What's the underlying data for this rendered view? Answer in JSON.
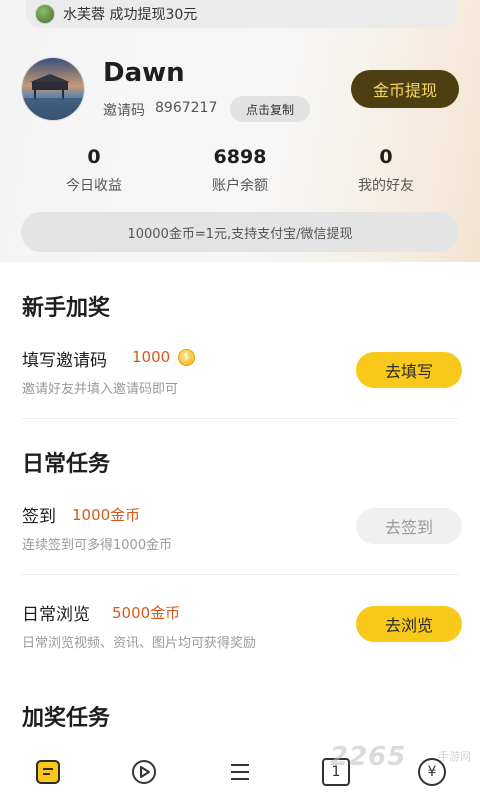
{
  "notice": {
    "text": "水芙蓉 成功提现30元"
  },
  "profile": {
    "username": "Dawn",
    "invite_label": "邀请码",
    "invite_code": "8967217",
    "copy_button": "点击复制",
    "withdraw_button": "金币提现"
  },
  "stats": [
    {
      "value": "0",
      "label": "今日收益"
    },
    {
      "value": "6898",
      "label": "账户余额"
    },
    {
      "value": "0",
      "label": "我的好友"
    }
  ],
  "rate_info": "10000金币=1元,支持支付宝/微信提现",
  "sections": {
    "newbie": {
      "title": "新手加奖",
      "task": {
        "title": "填写邀请码",
        "reward": "1000",
        "desc": "邀请好友并填入邀请码即可",
        "button": "去填写"
      }
    },
    "daily": {
      "title": "日常任务",
      "tasks": [
        {
          "title": "签到",
          "reward": "1000金币",
          "desc": "连续签到可多得1000金币",
          "button": "去签到"
        },
        {
          "title": "日常浏览",
          "reward": "5000金币",
          "desc": "日常浏览视频、资讯、图片均可获得奖励",
          "button": "去浏览"
        }
      ]
    },
    "bonus": {
      "title": "加奖任务"
    }
  },
  "bottom_nav": {
    "icons": [
      "task-icon",
      "play-icon",
      "menu-icon",
      "number-icon",
      "yen-icon"
    ],
    "number_icon_text": "1",
    "yen_symbol": "¥"
  },
  "watermark": {
    "text": "2265",
    "sub": "手游网"
  },
  "colors": {
    "accent_yellow": "#f8c91a",
    "withdraw_bg": "#4d3f12",
    "withdraw_text": "#f7d764",
    "reward": "#d45a1c"
  }
}
